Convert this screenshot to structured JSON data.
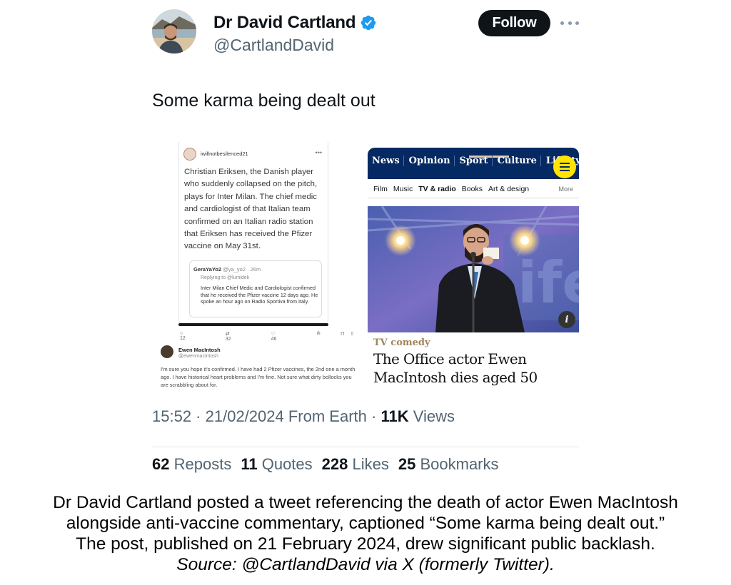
{
  "author": {
    "display_name": "Dr David Cartland",
    "handle": "@CartlandDavid",
    "verified": true,
    "verified_color": "#1d9bf0"
  },
  "follow_label": "Follow",
  "tweet_text": "Some karma being dealt out",
  "media": {
    "embedded_tweet": {
      "user": "iwillnotbesilenced21",
      "body": "Christian Eriksen, the Danish player who suddenly collapsed on the pitch, plays for Inter Milan. The chief medic and cardiologist of that Italian team confirmed on an Italian radio station that Eriksen has received the Pfizer vaccine on May 31st.",
      "quote": {
        "user": "GeraYaYo2",
        "meta": "@ya_yo2 · 26m",
        "replying_to": "Replying to @lumidek",
        "body": "Inter Milan Chief Medic and Cardiologist confirmed that he received the Pfizer vaccine 12 days ago. He spoke an hour ago on Radio Sportiva from Italy."
      },
      "actions": {
        "replies": "12",
        "reposts": "32",
        "likes": "46"
      },
      "reply": {
        "name": "Ewen MacIntosh",
        "handle": "@ewenmacintosh",
        "text": "I'm sure you hope it's confirmed. I have had 2 Pfizer vaccines, the 2nd one a month ago. I have historical heart problems and I'm fine. Not sure what dirty bollocks you are scrabbling about for."
      }
    },
    "guardian": {
      "nav": [
        "News",
        "Opinion",
        "Sport",
        "Culture",
        "Lifestyle"
      ],
      "subnav": [
        "Film",
        "Music",
        "TV & radio",
        "Books",
        "Art & design"
      ],
      "subnav_active": "TV & radio",
      "more": "More",
      "info": "i",
      "kicker": "TV comedy",
      "headline": "The Office actor Ewen MacIntosh dies aged 50",
      "brand_color": "#052962",
      "menu_color": "#ffe500"
    }
  },
  "meta": {
    "time": "15:52",
    "date": "21/02/2024",
    "source": "From Earth",
    "views_count": "11K",
    "views_label": "Views"
  },
  "stats": [
    {
      "count": "62",
      "label": "Reposts"
    },
    {
      "count": "11",
      "label": "Quotes"
    },
    {
      "count": "228",
      "label": "Likes"
    },
    {
      "count": "25",
      "label": "Bookmarks"
    }
  ],
  "caption": {
    "line1": "Dr David Cartland posted a tweet referencing the death of actor Ewen MacIntosh",
    "line2": "alongside anti-vaccine commentary, captioned “Some karma being dealt out.”",
    "line3": "The post, published on 21 February 2024, drew significant public backlash.",
    "source": "Source: @CartlandDavid via X (formerly Twitter)."
  }
}
